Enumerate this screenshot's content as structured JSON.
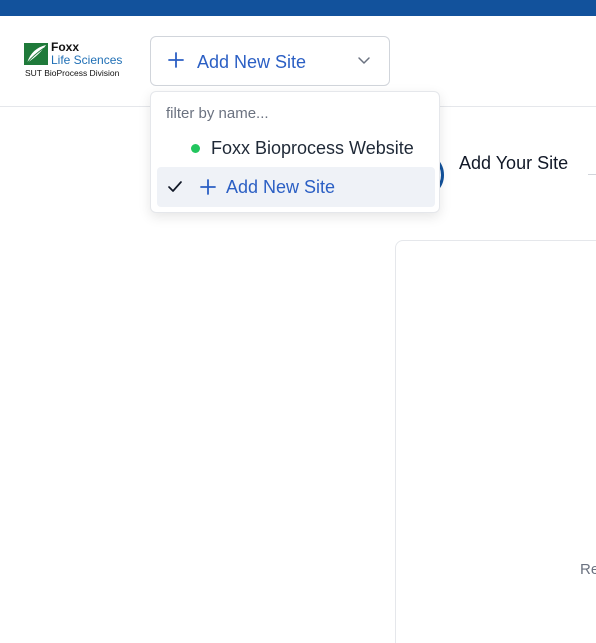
{
  "logo": {
    "line1": "Foxx",
    "line2": "Life Sciences",
    "line3": "SUT BioProcess Division"
  },
  "site_select": {
    "label": "Add New Site",
    "icon": "plus-icon",
    "caret_icon": "chevron-down-icon"
  },
  "dropdown": {
    "filter_placeholder": "filter by name...",
    "options": [
      {
        "label": "Foxx Bioprocess Website",
        "status_color": "#22c55e",
        "selected": false
      },
      {
        "label": "Add New Site",
        "selected": true
      }
    ]
  },
  "stepper": {
    "current_step_label": "Add Your Site"
  },
  "card": {
    "partial_text": "Re"
  },
  "colors": {
    "brand_blue": "#12529c",
    "link_blue": "#2b5fc4",
    "online_green": "#22c55e"
  }
}
